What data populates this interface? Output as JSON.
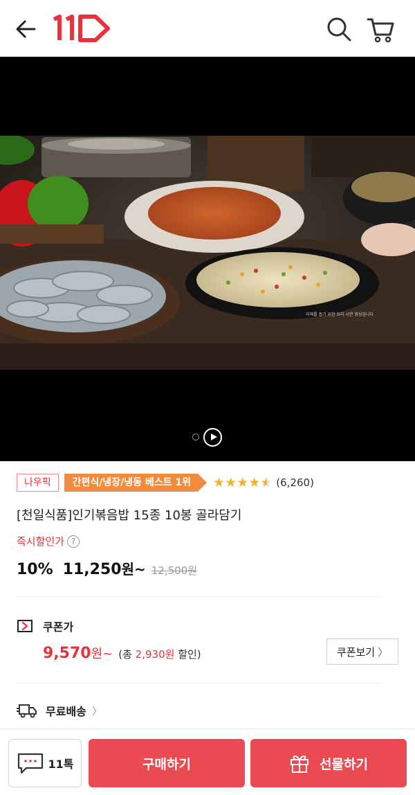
{
  "header": {
    "logo_text": "11",
    "icons": {
      "back": "back-arrow-icon",
      "search": "search-icon",
      "cart": "cart-icon"
    },
    "brand_color": "#e8323c"
  },
  "media": {
    "caption": "이해를 돕기 위한 요리 시연 영상입니다",
    "controls": {
      "play": "play-icon"
    }
  },
  "product": {
    "badge_now": "나우픽",
    "badge_best": "간편식/냉장/냉동 베스트 1위",
    "rating": 4.5,
    "review_count": "(6,260)",
    "title": "[천일식품]인기볶음밥 15종 10봉 골라담기",
    "instant_discount_label": "즉시할인가",
    "help_icon_text": "?",
    "discount": "10%",
    "price": "11,250",
    "price_suffix": "원~",
    "original_price": "12,500원"
  },
  "coupon": {
    "title": "쿠폰가",
    "price": "9,570",
    "price_suffix": "원~",
    "note_prefix": "(총 ",
    "note_amount": "2,930원",
    "note_suffix": " 할인)",
    "view_button": "쿠폰보기",
    "view_chevron": "〉"
  },
  "shipping": {
    "label": "무료배송",
    "chevron": "〉"
  },
  "bottom_bar": {
    "talk_label": "11톡",
    "buy_label": "구매하기",
    "gift_label": "선물하기",
    "button_color": "#ea4a52"
  }
}
